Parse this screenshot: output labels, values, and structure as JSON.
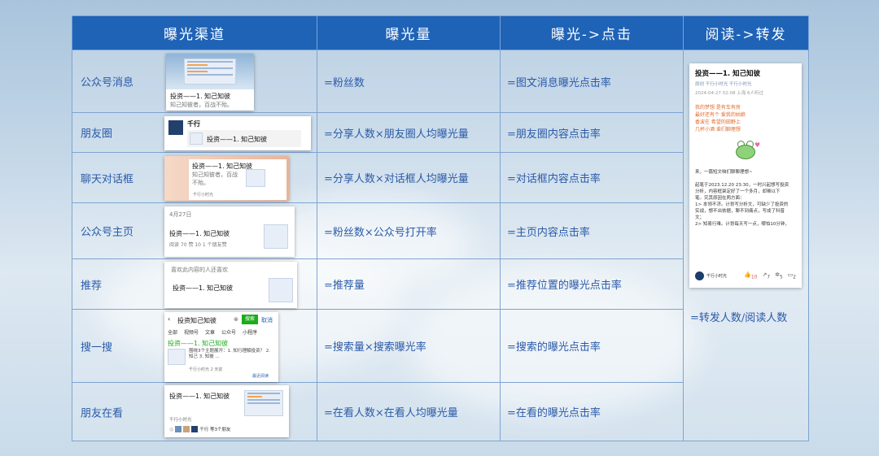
{
  "headers": [
    "曝光渠道",
    "曝光量",
    "曝光->点击",
    "阅读->转发"
  ],
  "rows": [
    {
      "channel": "公众号消息",
      "exposure": "=粉丝数",
      "click": "=图文消息曝光点击率"
    },
    {
      "channel": "朋友圈",
      "exposure": "=分享人数×朋友圈人均曝光量",
      "click": "=朋友圈内容点击率"
    },
    {
      "channel": "聊天对话框",
      "exposure": "=分享人数×对话框人均曝光量",
      "click": "=对话框内容点击率"
    },
    {
      "channel": "公众号主页",
      "exposure": "=粉丝数×公众号打开率",
      "click": "=主页内容点击率"
    },
    {
      "channel": "推荐",
      "exposure": "=推荐量",
      "click": "=推荐位置的曝光点击率"
    },
    {
      "channel": "搜一搜",
      "exposure": "=搜索量×搜索曝光率",
      "click": "=搜索的曝光点击率"
    },
    {
      "channel": "朋友在看",
      "exposure": "=在看人数×在看人均曝光量",
      "click": "=在看的曝光点击率"
    }
  ],
  "read_forward": "=转发人数/阅读人数",
  "thumbs": {
    "msg": {
      "title": "投资——1. 知己知彼",
      "sub": "知己知彼者，百战不殆。"
    },
    "moments": {
      "user": "千行",
      "title": "投资——1. 知己知彼"
    },
    "chat": {
      "title": "投资——1. 知己知彼",
      "sub": "知己知彼者，百战不殆。",
      "src": "千行小时光"
    },
    "home": {
      "date": "4月27日",
      "title": "投资——1. 知己知彼",
      "stats": "阅读 70  赞 10  1 个朋友赞"
    },
    "rec": {
      "hint": "喜欢此内容的人还喜欢",
      "title": "投资——1. 知己知彼"
    },
    "search": {
      "query": "投资知己知彼",
      "btn": "搜索",
      "cancel": "取消",
      "tabs": [
        "全部",
        "视频号",
        "文章",
        "公众号",
        "小程序"
      ],
      "title": "投资——1. 知己知彼",
      "snippet": "围绕3个主题展开：1. 知行理解投资？ 2. 知己 3. 知彼 ...",
      "meta": "千行小时光  2 天前",
      "recent": "最近阅读"
    },
    "looking": {
      "title": "投资——1. 知己知彼",
      "src": "千行小时光",
      "friends": "千行 等3个朋友"
    }
  },
  "article": {
    "title": "投资——1. 知己知彼",
    "meta": "原创  千行小时光  千行小时光",
    "date": "2024-04-27 02:08  上海  6人听过",
    "poem": [
      "我的梦想 是有车有房",
      "最好还有个 爱我的姑娘",
      "香波在 希望的田野上",
      "几杯小酒 谁们聊理想"
    ],
    "line1": "来，一篇短文咱们聊聊理想~",
    "body": [
      "起笔于2023.12.20 23:30，一时兴起想写投资",
      "分析，内容框架定好了一个多月，却难以下",
      "笔。究其原因在两方面：",
      "1> 本领不济。计划写分析文，可缺少了投资的",
      "实战，想不出依据，聊不到痛点，写成了科普",
      "文；",
      "2> 知易行难。计划每天写一点，哪怕10分钟，"
    ],
    "author": "千行小时光",
    "counts": [
      "10",
      "7",
      "5",
      "2"
    ]
  }
}
